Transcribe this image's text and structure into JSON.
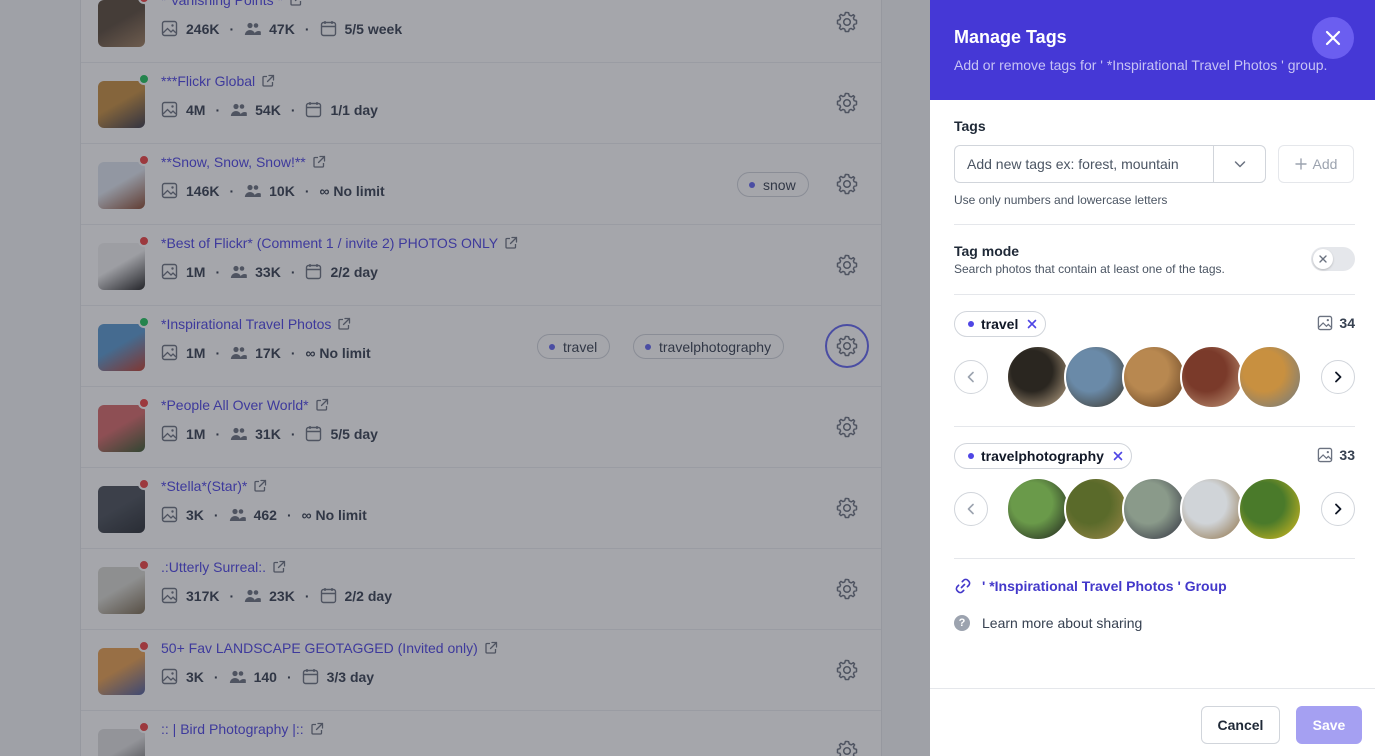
{
  "background": {
    "groups": [
      {
        "title": "* Vanishing Points *",
        "photos": "246K",
        "members": "47K",
        "limit": "5/5 week",
        "limit_type": "calendar",
        "status": "red",
        "tags": [],
        "colors": [
          "#5a4a3a",
          "#a08060"
        ]
      },
      {
        "title": "***Flickr Global",
        "photos": "4M",
        "members": "54K",
        "limit": "1/1 day",
        "limit_type": "calendar",
        "status": "green",
        "tags": [],
        "colors": [
          "#c89040",
          "#3a3a4a"
        ]
      },
      {
        "title": "**Snow, Snow, Snow!**",
        "photos": "146K",
        "members": "10K",
        "limit": "∞ No limit",
        "limit_type": "infinity",
        "status": "red",
        "tags": [
          "snow"
        ],
        "colors": [
          "#dfe6ef",
          "#8a4a30"
        ]
      },
      {
        "title": "*Best of Flickr* (Comment 1 / invite 2) PHOTOS ONLY",
        "photos": "1M",
        "members": "33K",
        "limit": "2/2 day",
        "limit_type": "calendar",
        "status": "red",
        "tags": [],
        "colors": [
          "#f2f2f2",
          "#222222"
        ]
      },
      {
        "title": "*Inspirational Travel Photos",
        "photos": "1M",
        "members": "17K",
        "limit": "∞ No limit",
        "limit_type": "infinity",
        "status": "green",
        "tags": [
          "travel",
          "travelphotography"
        ],
        "active": true,
        "colors": [
          "#5a9ad0",
          "#c04030"
        ]
      },
      {
        "title": "*People All Over World*",
        "photos": "1M",
        "members": "31K",
        "limit": "5/5 day",
        "limit_type": "calendar",
        "status": "red",
        "tags": [],
        "colors": [
          "#d86a6a",
          "#3a5a30"
        ]
      },
      {
        "title": "*Stella*(Star)*",
        "photos": "3K",
        "members": "462",
        "limit": "∞ No limit",
        "limit_type": "infinity",
        "status": "red",
        "tags": [],
        "colors": [
          "#4a5058",
          "#2a2e34"
        ]
      },
      {
        "title": ".:Utterly Surreal:.",
        "photos": "317K",
        "members": "23K",
        "limit": "2/2 day",
        "limit_type": "calendar",
        "status": "red",
        "tags": [],
        "colors": [
          "#d8d8d0",
          "#7a6a50"
        ]
      },
      {
        "title": "50+ Fav LANDSCAPE GEOTAGGED (Invited only)",
        "photos": "3K",
        "members": "140",
        "limit": "3/3 day",
        "limit_type": "calendar",
        "status": "red",
        "tags": [],
        "colors": [
          "#e8a050",
          "#5060a0"
        ]
      },
      {
        "title": ":: | Bird Photography |::",
        "photos": "",
        "members": "",
        "limit": "",
        "limit_type": "calendar",
        "status": "red",
        "tags": [],
        "colors": [
          "#e0e0e0",
          "#505050"
        ]
      }
    ]
  },
  "drawer": {
    "title": "Manage Tags",
    "subtitle": "Add or remove tags for ' *Inspirational Travel Photos ' group.",
    "tags_label": "Tags",
    "input_placeholder": "Add new tags ex: forest, mountain",
    "add_label": "Add",
    "hint": "Use only numbers and lowercase letters",
    "mode_title": "Tag mode",
    "mode_sub": "Search photos that contain at least one of the tags.",
    "tag_groups": [
      {
        "name": "travel",
        "count": "34",
        "photos": [
          [
            "#2a2620",
            "#c8b090"
          ],
          [
            "#6a8aa8",
            "#3a3020"
          ],
          [
            "#b88850",
            "#5a3a20"
          ],
          [
            "#7a3a2a",
            "#c8a080"
          ],
          [
            "#c89040",
            "#6a7a88"
          ]
        ]
      },
      {
        "name": "travelphotography",
        "count": "33",
        "photos": [
          [
            "#6a9a4a",
            "#1a1a1a"
          ],
          [
            "#5a6a2a",
            "#a08a4a"
          ],
          [
            "#8a9a8a",
            "#2a2a3a"
          ],
          [
            "#d0d4d8",
            "#8a6a3a"
          ],
          [
            "#4a7a2a",
            "#e0c020"
          ]
        ]
      }
    ],
    "group_link": "' *Inspirational Travel Photos ' Group",
    "learn_more": "Learn more about sharing",
    "cancel_label": "Cancel",
    "save_label": "Save"
  },
  "colors": {
    "header": "#4538d6",
    "accent": "#4f46e5",
    "save_disabled": "#a5a0f2"
  }
}
